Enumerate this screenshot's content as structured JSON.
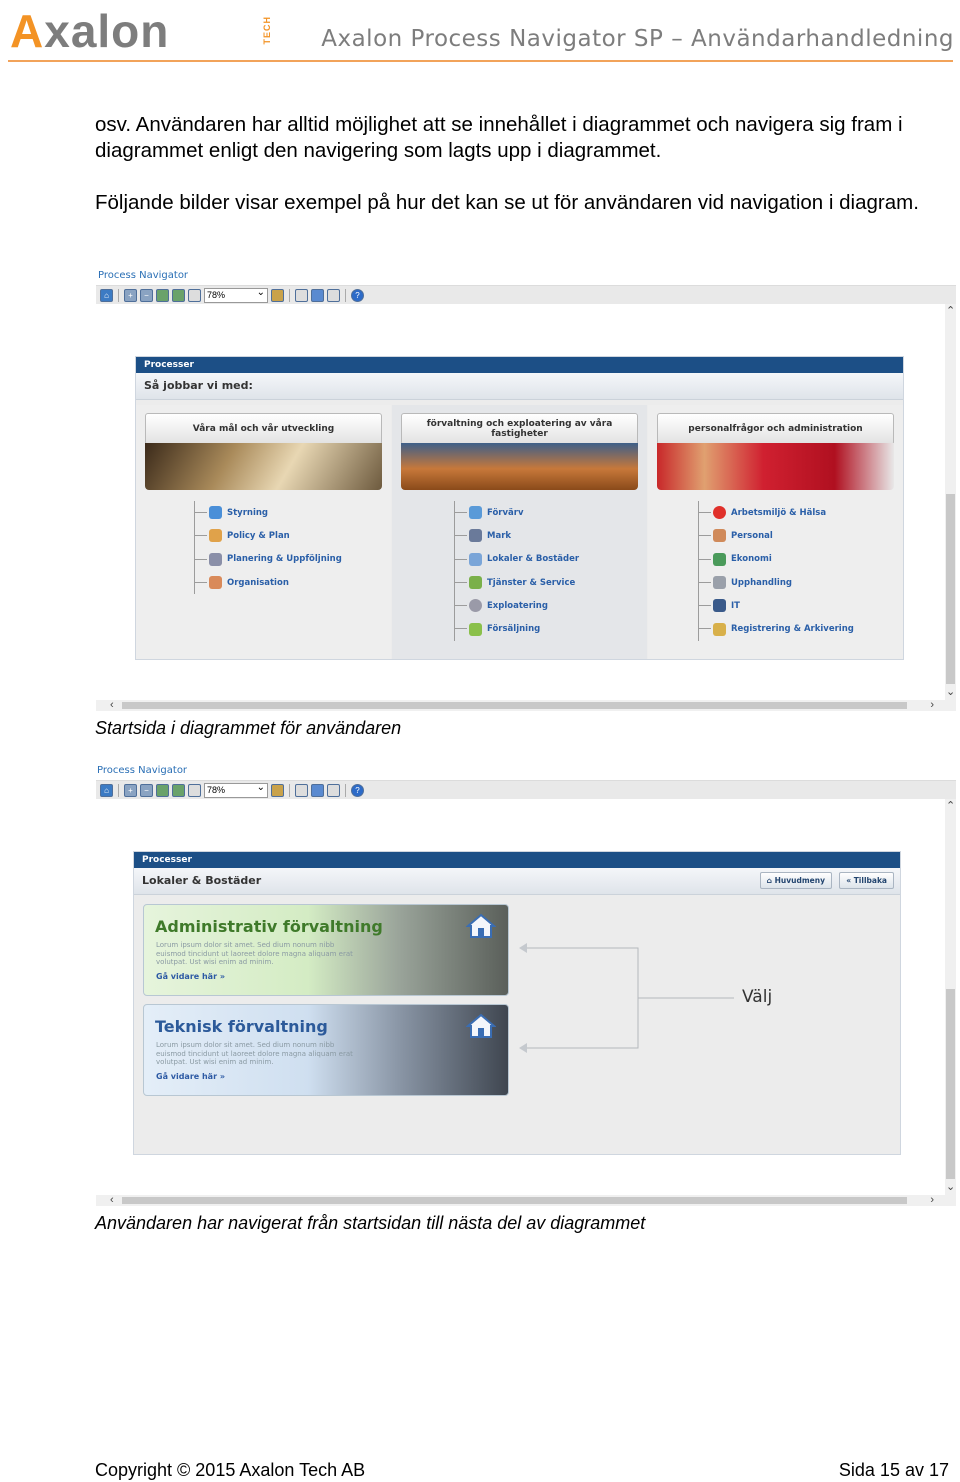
{
  "header": {
    "logo_text": "Axalon",
    "logo_sub": "TECH",
    "title": "Axalon Process Navigator SP – Användarhandledning",
    "accent_color": "#f39325"
  },
  "paragraphs": {
    "p1": "osv. Användaren har alltid möjlighet att se innehållet i diagrammet och navigera sig fram i diagrammet enligt den navigering som lagts upp i diagrammet.",
    "p2": "Följande bilder visar exempel på hur det kan se ut för användaren vid navigation i diagram."
  },
  "screenshot1": {
    "app_label": "Process Navigator",
    "zoom_value": "78%",
    "panel_title": "Processer",
    "panel_subtitle": "Så jobbar vi med:",
    "columns": [
      {
        "heading": "Våra mål och vår utveckling",
        "items": [
          "Styrning",
          "Policy & Plan",
          "Planering & Uppföljning",
          "Organisation"
        ]
      },
      {
        "heading": "förvaltning och exploatering av våra fastigheter",
        "items": [
          "Förvärv",
          "Mark",
          "Lokaler & Bostäder",
          "Tjänster & Service",
          "Exploatering",
          "Försäljning"
        ]
      },
      {
        "heading": "personalfrågor och administration",
        "items": [
          "Arbetsmiljö & Hälsa",
          "Personal",
          "Ekonomi",
          "Upphandling",
          "IT",
          "Registrering & Arkivering"
        ]
      }
    ],
    "caption": "Startsida i diagrammet för användaren"
  },
  "screenshot2": {
    "app_label": "Process Navigator",
    "zoom_value": "78%",
    "panel_title": "Processer",
    "panel_subtitle": "Lokaler & Bostäder",
    "btn_main_menu": "Huvudmeny",
    "btn_back": "« Tillbaka",
    "cards": [
      {
        "title": "Administrativ förvaltning",
        "body": "Lorum ipsum dolor sit amet. Sed dium nonum nibb euismod tincidunt ut laoreet dolore magna aliquam erat volutpat. Ust wisi enim ad minim.",
        "more": "Gå vidare här »"
      },
      {
        "title": "Teknisk förvaltning",
        "body": "Lorum ipsum dolor sit amet. Sed dium nonum nibb euismod tincidunt ut laoreet dolore magna aliquam erat volutpat. Ust wisi enim ad minim.",
        "more": "Gå vidare här »"
      }
    ],
    "choose_label": "Välj",
    "caption": "Användaren har navigerat från startsidan till nästa del av diagrammet"
  },
  "footer": {
    "copyright": "Copyright © 2015 Axalon Tech AB",
    "page": "Sida 15 av 17"
  }
}
